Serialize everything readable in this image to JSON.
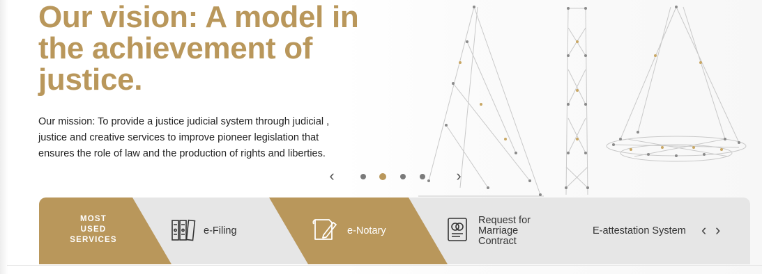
{
  "hero": {
    "headline": "Our vision: A model in the achievement of justice.",
    "mission": "Our mission: To provide a justice judicial system through judicial , justice and creative services to improve pioneer legislation that ensures the role of law and the production of rights and liberties.",
    "slider": {
      "prev_label": "‹",
      "next_label": "›",
      "slide_count": 4,
      "active_index": 1
    }
  },
  "services_bar": {
    "title_lines": [
      "MOST",
      "USED",
      "SERVICES"
    ],
    "items": [
      {
        "label": "e-Filing",
        "icon": "binders-icon",
        "active": false
      },
      {
        "label": "e-Notary",
        "icon": "document-pen-icon",
        "active": true
      },
      {
        "label": "Request for Marriage Contract",
        "icon": "rings-contract-icon",
        "active": false
      },
      {
        "label": "E-attestation System",
        "icon": "",
        "active": false
      }
    ],
    "prev_label": "‹",
    "next_label": "›"
  },
  "colors": {
    "gold": "#b9975b",
    "bar_bg": "#e6e6e6",
    "text": "#222222"
  }
}
